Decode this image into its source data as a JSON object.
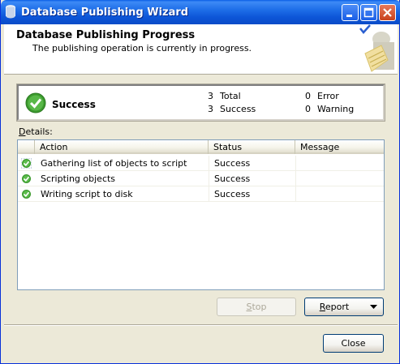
{
  "window": {
    "title": "Database Publishing Wizard"
  },
  "header": {
    "title": "Database Publishing Progress",
    "subtitle": "The publishing operation is currently in progress."
  },
  "summary": {
    "status": "Success",
    "total_count": "3",
    "total_label": "Total",
    "success_count": "3",
    "success_label": "Success",
    "error_count": "0",
    "error_label": "Error",
    "warning_count": "0",
    "warning_label": "Warning"
  },
  "details": {
    "label_prefix": "D",
    "label_rest": "etails:",
    "columns": {
      "action": "Action",
      "status": "Status",
      "message": "Message"
    },
    "rows": [
      {
        "action": "Gathering list of objects to script",
        "status": "Success",
        "message": ""
      },
      {
        "action": "Scripting objects",
        "status": "Success",
        "message": ""
      },
      {
        "action": "Writing script to disk",
        "status": "Success",
        "message": ""
      }
    ]
  },
  "buttons": {
    "stop_prefix": "S",
    "stop_rest": "top",
    "report_prefix": "R",
    "report_rest": "eport",
    "close": "Close"
  },
  "colors": {
    "titlebar": "#0a5fe6",
    "success_green": "#3c9a2e",
    "window_bg": "#ece9d8"
  }
}
